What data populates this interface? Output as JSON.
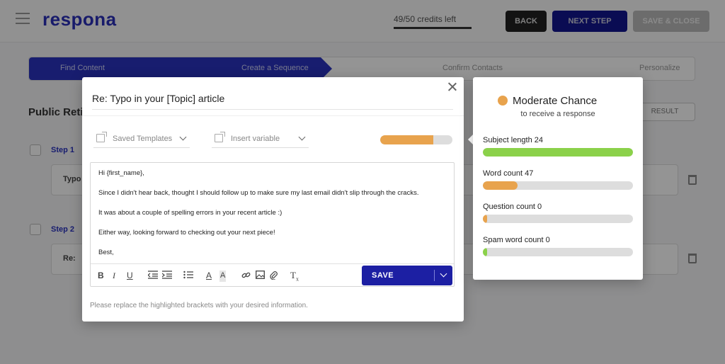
{
  "app": {
    "logo": "respona",
    "credits": "49/50 credits left",
    "back_label": "BACK",
    "next_label": "NEXT STEP",
    "save_close_label": "SAVE & CLOSE"
  },
  "steps": [
    {
      "label": "Find Content"
    },
    {
      "label": "Create a Sequence"
    },
    {
      "label": "Confirm Contacts"
    },
    {
      "label": "Personalize"
    }
  ],
  "page": {
    "title": "Public Reti",
    "result_label": "RESULT",
    "step1_label": "Step 1",
    "step1_card": "Typo",
    "step2_label": "Step 2",
    "step2_card": "Re:"
  },
  "modal": {
    "subject": "Re: Typo in your [Topic] article",
    "saved_templates": "Saved Templates",
    "insert_variable": "Insert variable",
    "score_fraction": 0.74,
    "body": [
      "Hi {first_name},",
      "Since I didn't hear back, thought I should follow up to make sure my last email didn't slip through the cracks.",
      "It was about a couple of spelling errors in your recent article :)",
      "Either way, looking forward to checking out your next piece!",
      "Best,"
    ],
    "save_label": "SAVE",
    "footer_note": "Please replace the highlighted brackets with your desired information."
  },
  "chance": {
    "title": "Moderate Chance",
    "subtitle": "to receive a response",
    "dot_color": "#e8a34d",
    "metrics": [
      {
        "label": "Subject length 24",
        "fraction": 1.0,
        "color": "#8bd14a"
      },
      {
        "label": "Word count 47",
        "fraction": 0.23,
        "color": "#e8a34d"
      },
      {
        "label": "Question count 0",
        "fraction": 0.03,
        "color": "#e8a34d"
      },
      {
        "label": "Spam word count 0",
        "fraction": 0.03,
        "color": "#8bd14a"
      }
    ]
  }
}
